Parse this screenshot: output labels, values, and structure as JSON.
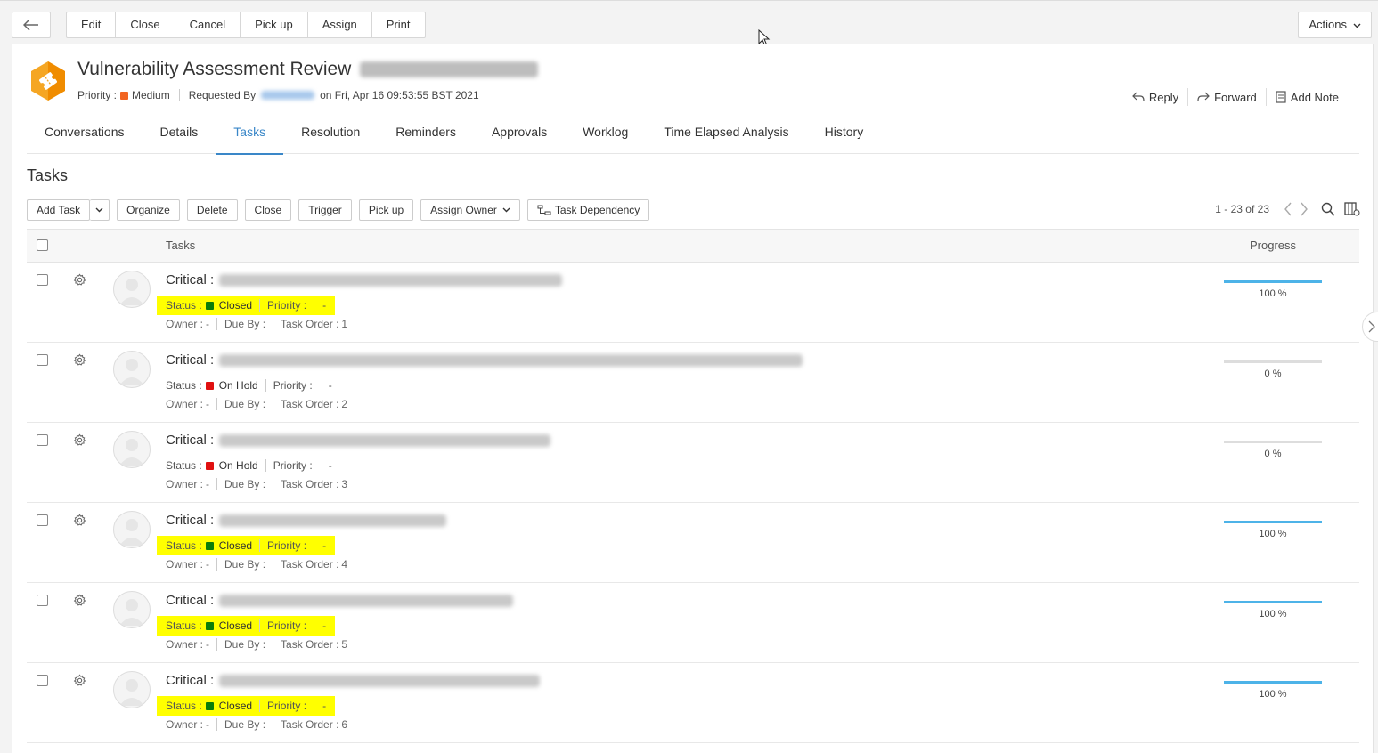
{
  "toolbar": {
    "buttons": [
      "Edit",
      "Close",
      "Cancel",
      "Pick up",
      "Assign",
      "Print"
    ],
    "actions_label": "Actions"
  },
  "request": {
    "title": "Vulnerability Assessment Review",
    "priority_label": "Priority :",
    "priority_value": "Medium",
    "priority_color": "#f26522",
    "requested_by_label": "Requested By",
    "requested_on": "on Fri, Apr 16 09:53:55 BST 2021"
  },
  "quick_actions": {
    "reply": "Reply",
    "forward": "Forward",
    "add_note": "Add Note"
  },
  "tabs": [
    "Conversations",
    "Details",
    "Tasks",
    "Resolution",
    "Reminders",
    "Approvals",
    "Worklog",
    "Time Elapsed Analysis",
    "History"
  ],
  "active_tab": "Tasks",
  "tasks_section": {
    "title": "Tasks",
    "buttons": {
      "add_task": "Add Task",
      "organize": "Organize",
      "delete": "Delete",
      "close": "Close",
      "trigger": "Trigger",
      "pick_up": "Pick up",
      "assign_owner": "Assign Owner",
      "task_dependency": "Task Dependency"
    },
    "pagination": "1 - 23 of 23",
    "columns": {
      "tasks": "Tasks",
      "progress": "Progress"
    }
  },
  "labels": {
    "status": "Status :",
    "priority": "Priority :",
    "owner": "Owner :",
    "due_by": "Due By :",
    "task_order": "Task Order :"
  },
  "status_colors": {
    "Closed": "#0a7d0a",
    "On Hold": "#e01010"
  },
  "rows": [
    {
      "prefix": "Critical :",
      "status": "Closed",
      "priority": "-",
      "owner": "-",
      "due_by": "",
      "task_order": "1",
      "progress_value": 100,
      "progress_text": "100 %",
      "highlighted": true
    },
    {
      "prefix": "Critical :",
      "status": "On Hold",
      "priority": "-",
      "owner": "-",
      "due_by": "",
      "task_order": "2",
      "progress_value": 0,
      "progress_text": "0 %",
      "highlighted": false
    },
    {
      "prefix": "Critical :",
      "status": "On Hold",
      "priority": "-",
      "owner": "-",
      "due_by": "",
      "task_order": "3",
      "progress_value": 0,
      "progress_text": "0 %",
      "highlighted": false
    },
    {
      "prefix": "Critical :",
      "status": "Closed",
      "priority": "-",
      "owner": "-",
      "due_by": "",
      "task_order": "4",
      "progress_value": 100,
      "progress_text": "100 %",
      "highlighted": true
    },
    {
      "prefix": "Critical :",
      "status": "Closed",
      "priority": "-",
      "owner": "-",
      "due_by": "",
      "task_order": "5",
      "progress_value": 100,
      "progress_text": "100 %",
      "highlighted": true
    },
    {
      "prefix": "Critical :",
      "status": "Closed",
      "priority": "-",
      "owner": "-",
      "due_by": "",
      "task_order": "6",
      "progress_value": 100,
      "progress_text": "100 %",
      "highlighted": true
    }
  ]
}
